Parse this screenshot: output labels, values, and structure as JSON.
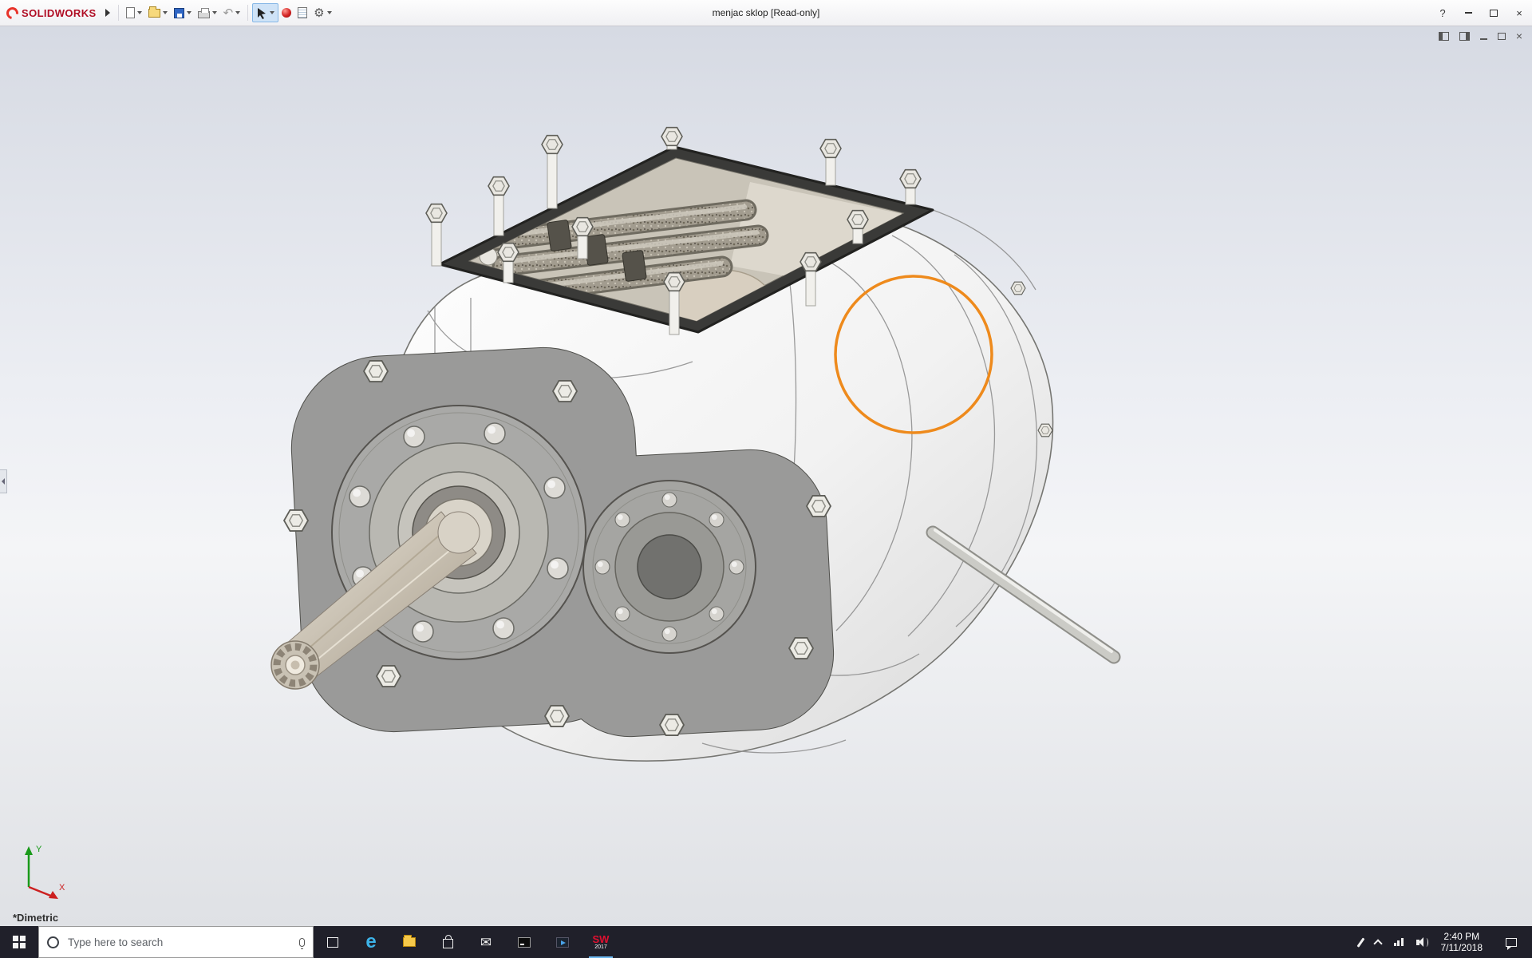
{
  "titlebar": {
    "brand": "SOLIDWORKS",
    "document_title": "menjac sklop [Read-only]"
  },
  "window": {
    "help": "?",
    "close": "×"
  },
  "icons": {
    "undo_glyph": "↶",
    "gear_glyph": "⚙",
    "edge_glyph": "e",
    "mail_glyph": "✉"
  },
  "viewport": {
    "view_orientation": "*Dimetric",
    "triad": {
      "x_label": "X",
      "y_label": "Y"
    },
    "annotation_color": "#ee8a1c"
  },
  "taskbar": {
    "search_placeholder": "Type here to search",
    "sw_badge": {
      "letters": "SW",
      "year": "2017"
    },
    "clock": {
      "time": "2:40 PM",
      "date": "7/11/2018"
    }
  }
}
